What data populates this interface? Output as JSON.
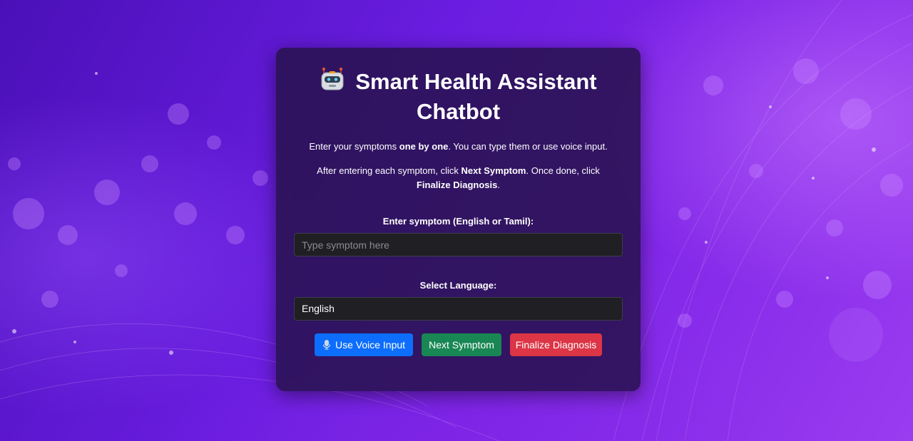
{
  "app": {
    "title": "Smart Health Assistant Chatbot",
    "title_icon": "robot-icon"
  },
  "intro": {
    "line1_a": "Enter your symptoms ",
    "line1_b": "one by one",
    "line1_c": ". You can type them or use voice input.",
    "line2_a": "After entering each symptom, click ",
    "line2_b": "Next Symptom",
    "line2_c": ". Once done, click ",
    "line2_d": "Finalize Diagnosis",
    "line2_e": "."
  },
  "symptom": {
    "label": "Enter symptom (English or Tamil):",
    "placeholder": "Type symptom here",
    "value": ""
  },
  "language": {
    "label": "Select Language:",
    "selected": "English"
  },
  "buttons": {
    "voice": {
      "label": "Use Voice Input",
      "icon": "microphone-icon",
      "color": "#0d6efd"
    },
    "next": {
      "label": "Next Symptom",
      "color": "#198754"
    },
    "finalize": {
      "label": "Finalize Diagnosis",
      "color": "#dc3545"
    }
  }
}
